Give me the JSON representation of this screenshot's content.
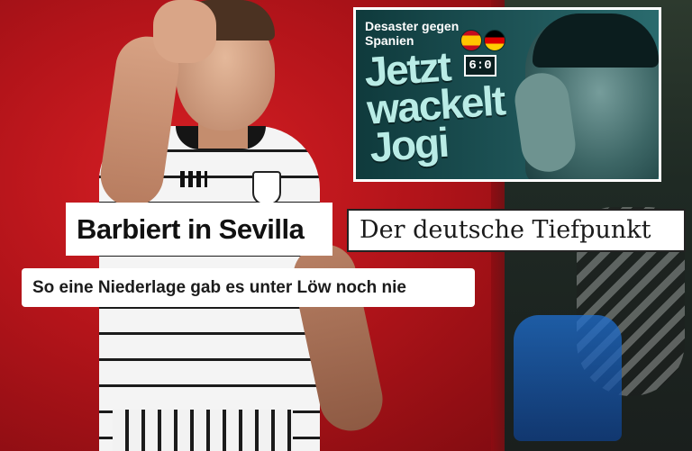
{
  "inset": {
    "kicker": "Desaster gegen Spanien",
    "score": "6:0",
    "headline": "Jetzt wackelt Jogi",
    "flags": [
      "spain-flag-icon",
      "germany-flag-icon"
    ]
  },
  "headlines": {
    "h1": "Barbiert in Sevilla",
    "h2": "Der deutsche Tiefpunkt",
    "h3": "So eine Niederlage gab es unter Löw noch nie"
  },
  "colors": {
    "background_red": "#b3141a",
    "inset_teal": "#1e5457",
    "inset_headline": "#b9ece6",
    "box_bg": "#ffffff",
    "box_text": "#111111"
  }
}
